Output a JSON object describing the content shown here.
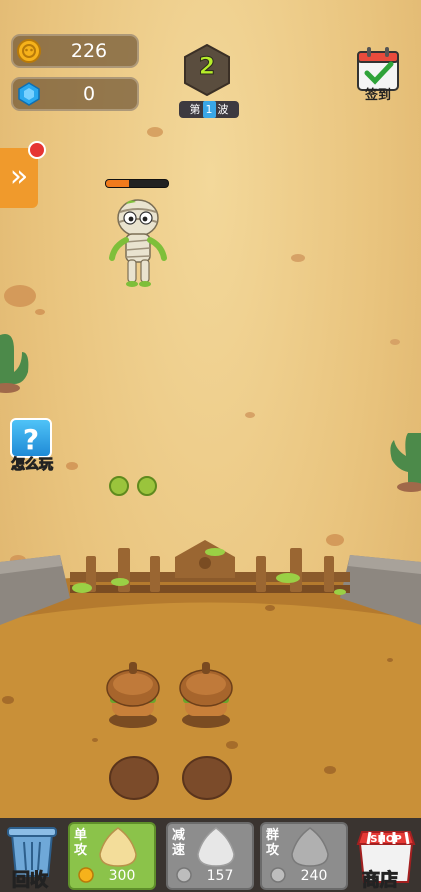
{
  "hud": {
    "coins": "226",
    "gems": "0",
    "wave_number": "2",
    "wave_prefix": "第",
    "wave_index": "1",
    "wave_suffix": "波",
    "checkin_label": "签到",
    "help_label": "怎么玩"
  },
  "enemy": {
    "hp_fraction": 0.37
  },
  "bottom": {
    "recycle_label": "回收",
    "shop_label": "商店",
    "shop_sign": "SHOP",
    "towers": [
      {
        "tag": "单攻",
        "cost": "300"
      },
      {
        "tag": "减速",
        "cost": "157"
      },
      {
        "tag": "群攻",
        "cost": "240"
      }
    ]
  },
  "colors": {
    "hud_pill": "#705634",
    "side_tab": "#f09a2c",
    "slot_active": "#8bc34a",
    "slot_inactive": "#8d8d8d"
  }
}
